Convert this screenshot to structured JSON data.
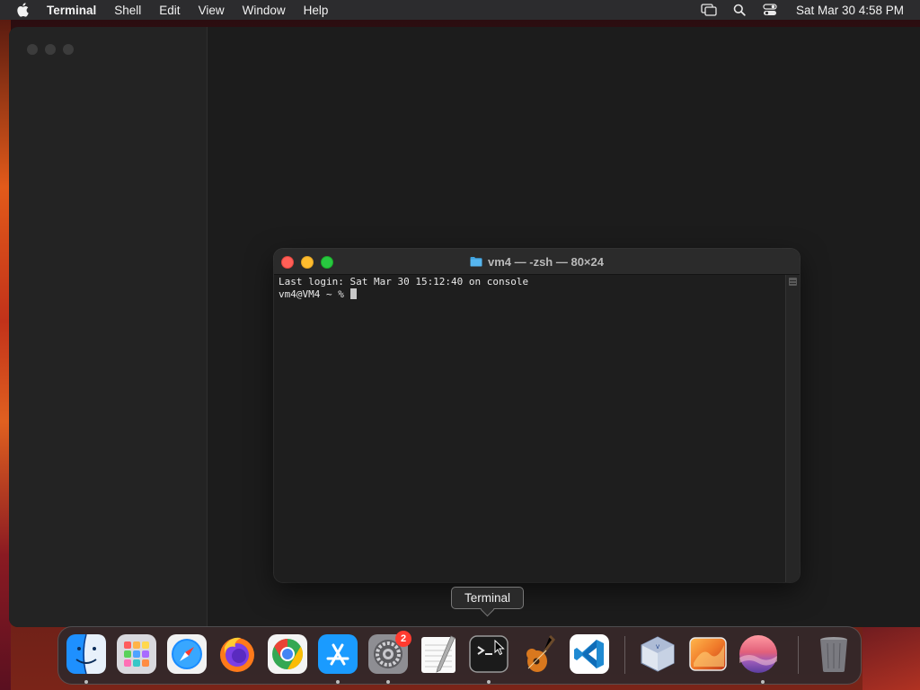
{
  "menubar": {
    "app_name": "Terminal",
    "items": [
      "Shell",
      "Edit",
      "View",
      "Window",
      "Help"
    ],
    "clock": "Sat Mar 30  4:58 PM",
    "status_icons": [
      "screen-mirroring-icon",
      "search-icon",
      "control-center-icon"
    ]
  },
  "terminal": {
    "title": "vm4 — -zsh — 80×24",
    "lines": [
      "Last login: Sat Mar 30 15:12:40 on console",
      "vm4@VM4 ~ % "
    ]
  },
  "tooltip": {
    "label": "Terminal"
  },
  "dock": {
    "apps": [
      {
        "name": "finder-icon",
        "running": true
      },
      {
        "name": "launchpad-icon",
        "running": false
      },
      {
        "name": "safari-icon",
        "running": false
      },
      {
        "name": "firefox-icon",
        "running": false
      },
      {
        "name": "chrome-icon",
        "running": false
      },
      {
        "name": "app-store-icon",
        "running": true
      },
      {
        "name": "system-settings-icon",
        "running": true,
        "badge": "2"
      },
      {
        "name": "textedit-icon",
        "running": false
      },
      {
        "name": "terminal-icon",
        "running": true
      },
      {
        "name": "garageband-icon",
        "running": false
      },
      {
        "name": "vscode-icon",
        "running": false
      },
      {
        "name": "virtualbox-icon",
        "running": false
      },
      {
        "name": "photo-wallpaper-icon",
        "running": false
      },
      {
        "name": "sonoma-wallpaper-icon",
        "running": true
      },
      {
        "name": "trash-icon",
        "running": false
      }
    ]
  },
  "colors": {
    "accent_red": "#ff5f57",
    "accent_yellow": "#febc2e",
    "accent_green": "#28c840",
    "badge": "#ff3b30"
  }
}
